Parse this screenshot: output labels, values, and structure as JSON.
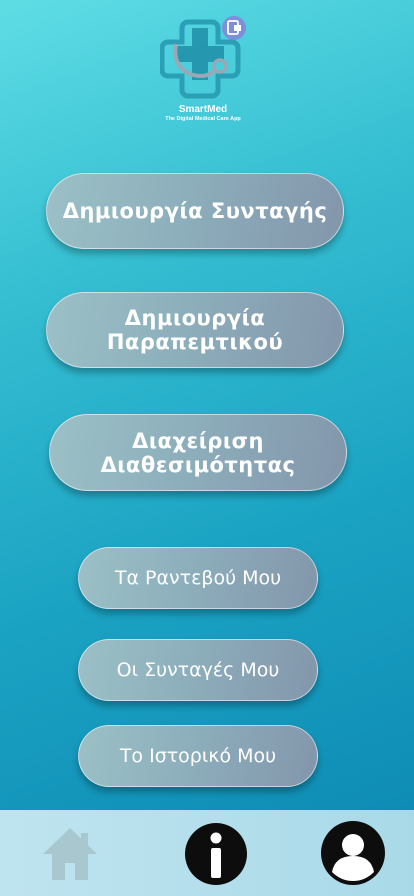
{
  "app": {
    "name": "SmartMed",
    "tagline": "The Digital Medical Care App"
  },
  "menu": {
    "buttons": [
      {
        "label": "Δημιουργία Συνταγής"
      },
      {
        "label": "Δημιουργία Παραπεμτικού"
      },
      {
        "label": "Διαχείριση Διαθεσιμότητας"
      },
      {
        "label": "Τα Ραντεβού Μου"
      },
      {
        "label": "Οι Συνταγές Μου"
      },
      {
        "label": "Το Ιστορικό Μου"
      }
    ]
  },
  "bottom_nav": {
    "items": [
      {
        "icon": "home-icon"
      },
      {
        "icon": "info-icon"
      },
      {
        "icon": "user-profile-icon"
      }
    ]
  },
  "colors": {
    "background_top": "#5fdde5",
    "background_bottom": "#0b86b1",
    "button_fill": "#8eb1bd",
    "navbar": "#b6deeb",
    "logo_cross": "#2a9fb5",
    "logo_badge": "#7d8fd8"
  }
}
